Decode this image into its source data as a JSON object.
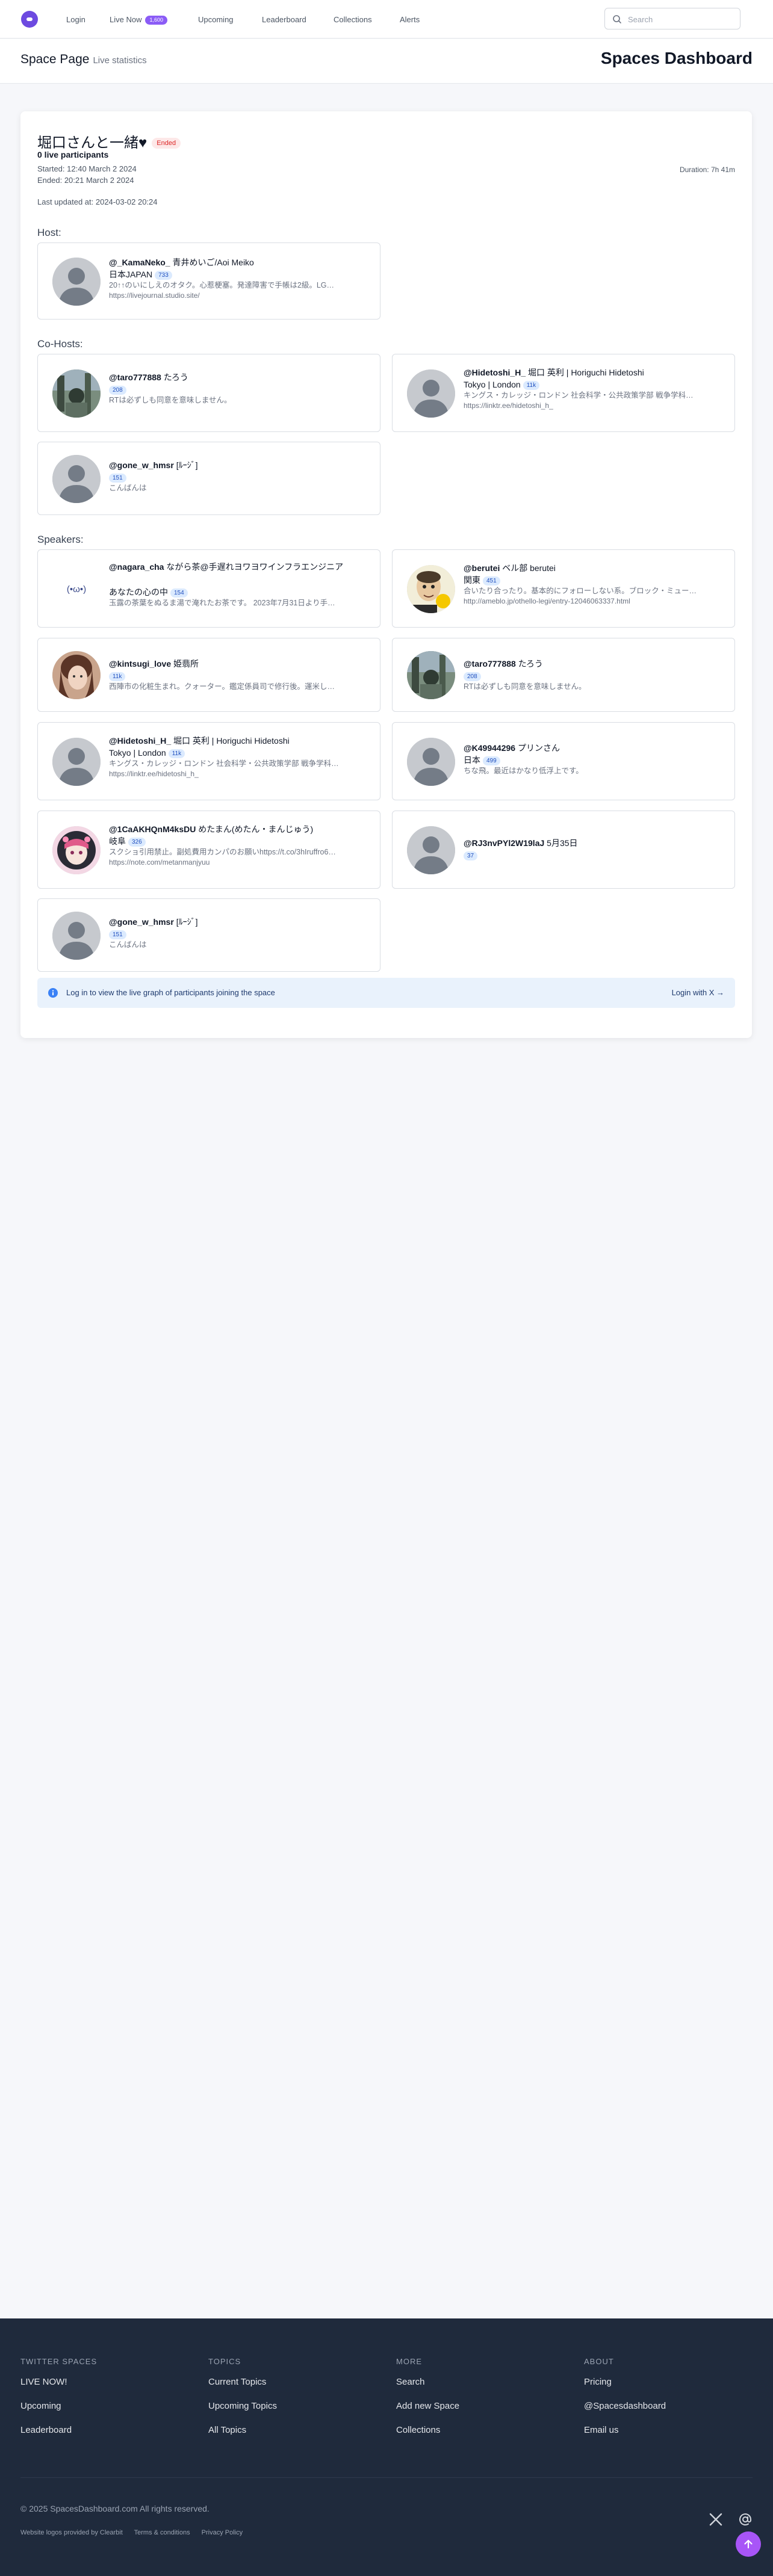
{
  "nav": {
    "login": "Login",
    "live_now": "Live Now",
    "live_count": "1,600",
    "upcoming": "Upcoming",
    "leaderboard": "Leaderboard",
    "collections": "Collections",
    "alerts": "Alerts",
    "search_placeholder": "Search"
  },
  "header": {
    "title": "Space Page",
    "subtitle": "Live statistics",
    "brand": "Spaces Dashboard"
  },
  "space": {
    "title": "堀口さんと一緒♥",
    "status": "Ended",
    "live_participants": "0 live participants",
    "started": "Started: 12:40 March 2 2024",
    "ended": "Ended: 20:21 March 2 2024",
    "last_updated": "Last updated at: 2024-03-02 20:24",
    "duration": "Duration: 7h 41m"
  },
  "labels": {
    "host": "Host:",
    "cohosts": "Co-Hosts:",
    "speakers": "Speakers:"
  },
  "host": {
    "handle": "@_KamaNeko_",
    "name": "青井めいご/Aoi Meiko",
    "location": "日本JAPAN",
    "count": "733",
    "bio": "20↑↑のいにしえのオタク。心惹梗塞。発達障害で手帳は2級。LG…",
    "link": "https://livejournal.studio.site/"
  },
  "cohosts": [
    {
      "handle": "@taro777888",
      "name": "たろう",
      "count": "208",
      "bio": "RTは必ずしも同意を意味しません。"
    },
    {
      "handle": "@Hidetoshi_H_",
      "name": "堀口 英利 | Horiguchi Hidetoshi",
      "location": "Tokyo | London",
      "count": "11k",
      "bio": "キングス・カレッジ・ロンドン 社会科学・公共政策学部 戦争学科…",
      "link": "https://linktr.ee/hidetoshi_h_"
    },
    {
      "handle": "@gone_w_hmsr",
      "name": "[ﾙｰｼﾞ]",
      "count": "151",
      "bio": "こんばんは"
    }
  ],
  "speakers": [
    {
      "handle": "@nagara_cha",
      "name": "ながら茶@手遅れヨワヨワインフラエンジニア",
      "location": "あなたの心の中",
      "count": "154",
      "bio": "玉露の茶葉をぬるま湯で淹れたお茶です。 2023年7月31日より手…",
      "avatar_text": "(•ω•)"
    },
    {
      "handle": "@berutei",
      "name": "ベル部 berutei",
      "location": "関東",
      "count": "451",
      "bio": "合いたり合ったり。基本的にフォローしない系。ブロック・ミュー…",
      "link": "http://ameblo.jp/othello-legi/entry-12046063337.html"
    },
    {
      "handle": "@kintsugi_love",
      "name": "姫翡所",
      "count": "11k",
      "bio": "西陣市の化粧生まれ。クォーター。鑑定係員司で修行後。運米し…"
    },
    {
      "handle": "@taro777888",
      "name": "たろう",
      "count": "208",
      "bio": "RTは必ずしも同意を意味しません。"
    },
    {
      "handle": "@Hidetoshi_H_",
      "name": "堀口 英利 | Horiguchi Hidetoshi",
      "location": "Tokyo | London",
      "count": "11k",
      "bio": "キングス・カレッジ・ロンドン 社会科学・公共政策学部 戦争学科…",
      "link": "https://linktr.ee/hidetoshi_h_"
    },
    {
      "handle": "@K49944296",
      "name": "プリンさん",
      "location": "日本",
      "count": "499",
      "bio": "ちな飛。最近はかなり低浮上です。"
    },
    {
      "handle": "@1CaAKHQnM4ksDU",
      "name": "めたまん(めたん・まんじゅう)",
      "location": "岐阜",
      "count": "326",
      "bio": "スクショ引用禁止。副処費用カンパのお願いhttps://t.co/3hIruffro6…",
      "link": "https://note.com/metanmanjyuu"
    },
    {
      "handle": "@RJ3nvPYl2W19laJ",
      "name": "5月35日",
      "count": "37"
    },
    {
      "handle": "@gone_w_hmsr",
      "name": "[ﾙｰｼﾞ]",
      "count": "151",
      "bio": "こんばんは"
    }
  ],
  "notice": {
    "message": "Log in to view the live graph of participants joining the space",
    "login_link": "Login with X →"
  },
  "footer": {
    "cols": [
      {
        "heading": "Twitter Spaces",
        "links": [
          "LIVE NOW!",
          "Upcoming",
          "Leaderboard"
        ]
      },
      {
        "heading": "Topics",
        "links": [
          "Current Topics",
          "Upcoming Topics",
          "All Topics"
        ]
      },
      {
        "heading": "More",
        "links": [
          "Search",
          "Add new Space",
          "Collections"
        ]
      },
      {
        "heading": "About",
        "links": [
          "Pricing",
          "@Spacesdashboard",
          "Email us"
        ]
      }
    ],
    "copyright": "© 2025 SpacesDashboard.com All rights reserved.",
    "small_links": [
      "Website logos provided by Clearbit",
      "Terms & conditions",
      "Privacy Policy"
    ]
  },
  "colors": {
    "accent": "#8b5cf6",
    "footer_bg": "#1f2a3c",
    "ended_badge": "#dc2626",
    "count_badge_bg": "#dbeafe"
  }
}
